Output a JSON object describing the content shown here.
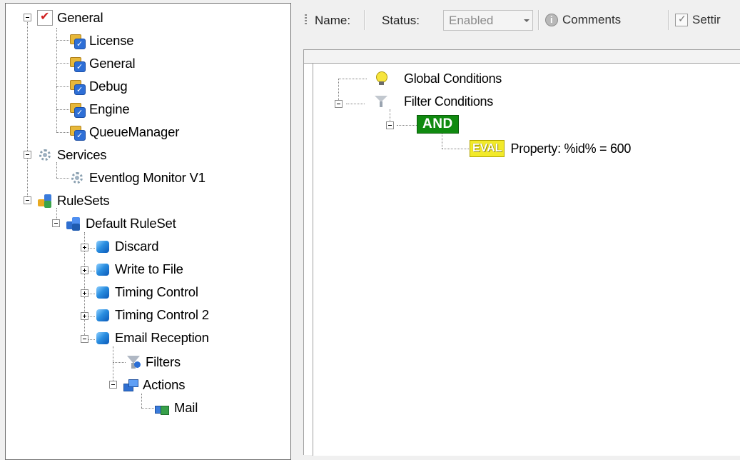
{
  "left_tree": {
    "general": "General",
    "license": "License",
    "general_child": "General",
    "debug": "Debug",
    "engine": "Engine",
    "queue_manager": "QueueManager",
    "services": "Services",
    "eventlog_monitor": "Eventlog Monitor V1",
    "rulesets": "RuleSets",
    "default_ruleset": "Default RuleSet",
    "discard": "Discard",
    "write_to_file": "Write to File",
    "timing_control": "Timing Control",
    "timing_control_2": "Timing Control 2",
    "email_reception": "Email Reception",
    "filters": "Filters",
    "actions": "Actions",
    "mail": "Mail"
  },
  "toolbar": {
    "name_label": "Name:",
    "status_label": "Status:",
    "status_value": "Enabled",
    "comments_label": "Comments",
    "settings_label": "Settir"
  },
  "filter_tree": {
    "global_conditions": "Global Conditions",
    "filter_conditions": "Filter Conditions",
    "and_operator": "AND",
    "eval_tag": "EVAL",
    "condition": "Property: %id% = 600"
  },
  "colors": {
    "and_green": "#108a10",
    "eval_yellow": "#f2ea2a",
    "cube_blue": "#2a8ee0"
  }
}
